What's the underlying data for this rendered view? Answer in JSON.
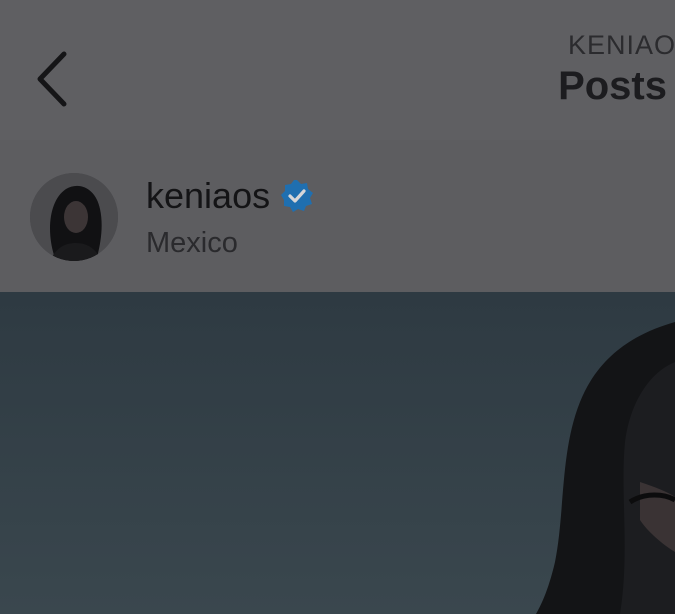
{
  "header": {
    "account_name": "KENIAOS",
    "title": "Posts",
    "back_icon": "chevron-left-icon"
  },
  "post": {
    "username": "keniaos",
    "verified_icon": "verified-badge-icon",
    "location": "Mexico"
  },
  "colors": {
    "verified_badge": "#1f6fb0",
    "dim_overlay": "#5d5d60"
  }
}
